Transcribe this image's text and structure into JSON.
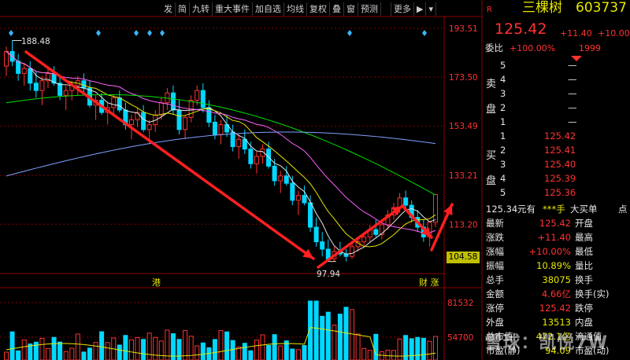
{
  "toolbar": {
    "buttons": [
      "发",
      "简",
      "九转",
      "重大事件",
      "加自选",
      "均线",
      "复权",
      "叠",
      "窗",
      "预测",
      "",
      "更多"
    ]
  },
  "price_axis": {
    "labels": [
      "193.51",
      "173.50",
      "153.49",
      "133.21",
      "113.20"
    ],
    "current_tag": "104.58",
    "volume_labels": [
      "81532",
      "54700"
    ]
  },
  "chart_annotations": {
    "high_label": "188.48",
    "low_label": "97.94",
    "event_left": "港",
    "event_right": "财 涨"
  },
  "quote": {
    "flag": "R",
    "name": "三棵树",
    "code": "603737",
    "price": "125.42",
    "change": "+11.40",
    "change_pct": "+10.00",
    "weibi_label": "委比",
    "weibi_value": "+100.00%",
    "weibi_diff": "1999",
    "sell_side_label": "卖盘",
    "buy_side_label": "买盘",
    "sell_levels": [
      {
        "n": "5",
        "price": "—"
      },
      {
        "n": "4",
        "price": "—"
      },
      {
        "n": "3",
        "price": "—"
      },
      {
        "n": "2",
        "price": "—"
      },
      {
        "n": "1",
        "price": "—"
      }
    ],
    "buy_levels": [
      {
        "n": "1",
        "price": "125.42"
      },
      {
        "n": "2",
        "price": "125.41"
      },
      {
        "n": "3",
        "price": "125.40"
      },
      {
        "n": "4",
        "price": "125.39"
      },
      {
        "n": "5",
        "price": "125.36"
      }
    ],
    "bar_price": "125.34",
    "bar_unit": "元有",
    "bar_stars": "***手",
    "bar_big": "大买单",
    "bar_dot": "点",
    "stats": [
      {
        "l": "最新",
        "v": "125.42",
        "r": "开盘"
      },
      {
        "l": "涨跌",
        "v": "+11.40",
        "r": "最高"
      },
      {
        "l": "涨幅",
        "v": "+10.00%",
        "r": "最低"
      },
      {
        "l": "振幅",
        "v": "10.89%",
        "r": "量比"
      },
      {
        "l": "总手",
        "v": "38075",
        "r": "换手"
      },
      {
        "l": "金额",
        "v": "4.66亿",
        "r": "换手(实)"
      },
      {
        "l": "涨停",
        "v": "125.42",
        "r": "跌停"
      },
      {
        "l": "外盘",
        "v": "13513",
        "r": "内盘"
      },
      {
        "l": "总市值",
        "v": "472.1亿",
        "r": "流通值"
      },
      {
        "l": "市盈(静)",
        "v": "94.09",
        "r": "市盈(动)"
      }
    ]
  },
  "watermark": "雪球：凯悦7W",
  "colors": {
    "up": "#ff3232",
    "down": "#00d8ff",
    "ma5": "#e8e8e8",
    "ma10": "#e8e800",
    "ma20": "#ff60ff",
    "ma60": "#00e000",
    "ma120": "#80a0ff"
  },
  "chart_data": {
    "type": "candlestick",
    "price_range": [
      93,
      198
    ],
    "candles": [
      [
        178,
        186,
        174,
        184
      ],
      [
        184,
        188.48,
        178,
        180
      ],
      [
        180,
        183,
        172,
        175
      ],
      [
        175,
        179,
        170,
        177
      ],
      [
        177,
        180,
        168,
        171
      ],
      [
        171,
        176,
        165,
        168
      ],
      [
        168,
        174,
        162,
        172
      ],
      [
        172,
        177,
        169,
        175
      ],
      [
        175,
        178,
        170,
        171
      ],
      [
        171,
        174,
        164,
        166
      ],
      [
        166,
        170,
        160,
        168
      ],
      [
        168,
        172,
        164,
        170
      ],
      [
        170,
        174,
        166,
        172
      ],
      [
        172,
        175,
        167,
        169
      ],
      [
        169,
        172,
        161,
        162
      ],
      [
        162,
        166,
        156,
        164
      ],
      [
        164,
        167,
        158,
        159
      ],
      [
        159,
        163,
        154,
        161
      ],
      [
        161,
        166,
        158,
        165
      ],
      [
        165,
        168,
        159,
        160
      ],
      [
        160,
        163,
        152,
        154
      ],
      [
        154,
        158,
        148,
        156
      ],
      [
        156,
        161,
        153,
        159
      ],
      [
        159,
        162,
        151,
        152
      ],
      [
        152,
        156,
        146,
        154
      ],
      [
        154,
        160,
        151,
        158
      ],
      [
        158,
        165,
        156,
        163
      ],
      [
        163,
        169,
        160,
        167
      ],
      [
        167,
        170,
        158,
        160
      ],
      [
        160,
        164,
        150,
        152
      ],
      [
        152,
        158,
        148,
        157
      ],
      [
        157,
        166,
        155,
        164
      ],
      [
        164,
        170,
        162,
        168
      ],
      [
        168,
        171,
        159,
        161
      ],
      [
        161,
        164,
        153,
        155
      ],
      [
        155,
        158,
        148,
        150
      ],
      [
        150,
        156,
        146,
        154
      ],
      [
        154,
        158,
        149,
        151
      ],
      [
        151,
        154,
        143,
        145
      ],
      [
        145,
        150,
        140,
        148
      ],
      [
        148,
        152,
        142,
        144
      ],
      [
        144,
        147,
        136,
        138
      ],
      [
        138,
        143,
        134,
        141
      ],
      [
        141,
        146,
        138,
        144
      ],
      [
        144,
        147,
        136,
        137
      ],
      [
        137,
        140,
        129,
        131
      ],
      [
        131,
        135,
        126,
        133
      ],
      [
        133,
        137,
        129,
        130
      ],
      [
        130,
        133,
        121,
        123
      ],
      [
        123,
        127,
        117,
        125
      ],
      [
        125,
        129,
        121,
        122
      ],
      [
        122,
        125,
        110,
        112
      ],
      [
        112,
        116,
        104,
        106
      ],
      [
        106,
        110,
        100,
        103
      ],
      [
        103,
        107,
        97.94,
        99
      ],
      [
        99,
        104,
        98,
        102
      ],
      [
        102,
        106,
        100,
        101
      ],
      [
        101,
        103,
        98,
        100
      ],
      [
        100,
        105,
        99,
        104
      ],
      [
        104,
        108,
        102,
        106
      ],
      [
        106,
        110,
        104,
        108
      ],
      [
        108,
        113,
        106,
        111
      ],
      [
        111,
        115,
        108,
        109
      ],
      [
        109,
        114,
        107,
        113
      ],
      [
        113,
        119,
        111,
        117
      ],
      [
        117,
        122,
        115,
        120
      ],
      [
        120,
        126,
        118,
        124
      ],
      [
        124,
        127,
        119,
        121
      ],
      [
        121,
        123,
        114,
        116
      ],
      [
        116,
        119,
        110,
        112
      ],
      [
        112,
        115,
        106,
        108
      ],
      [
        108,
        114,
        104,
        114.02
      ],
      [
        114.02,
        125.42,
        112,
        125.42
      ]
    ]
  }
}
